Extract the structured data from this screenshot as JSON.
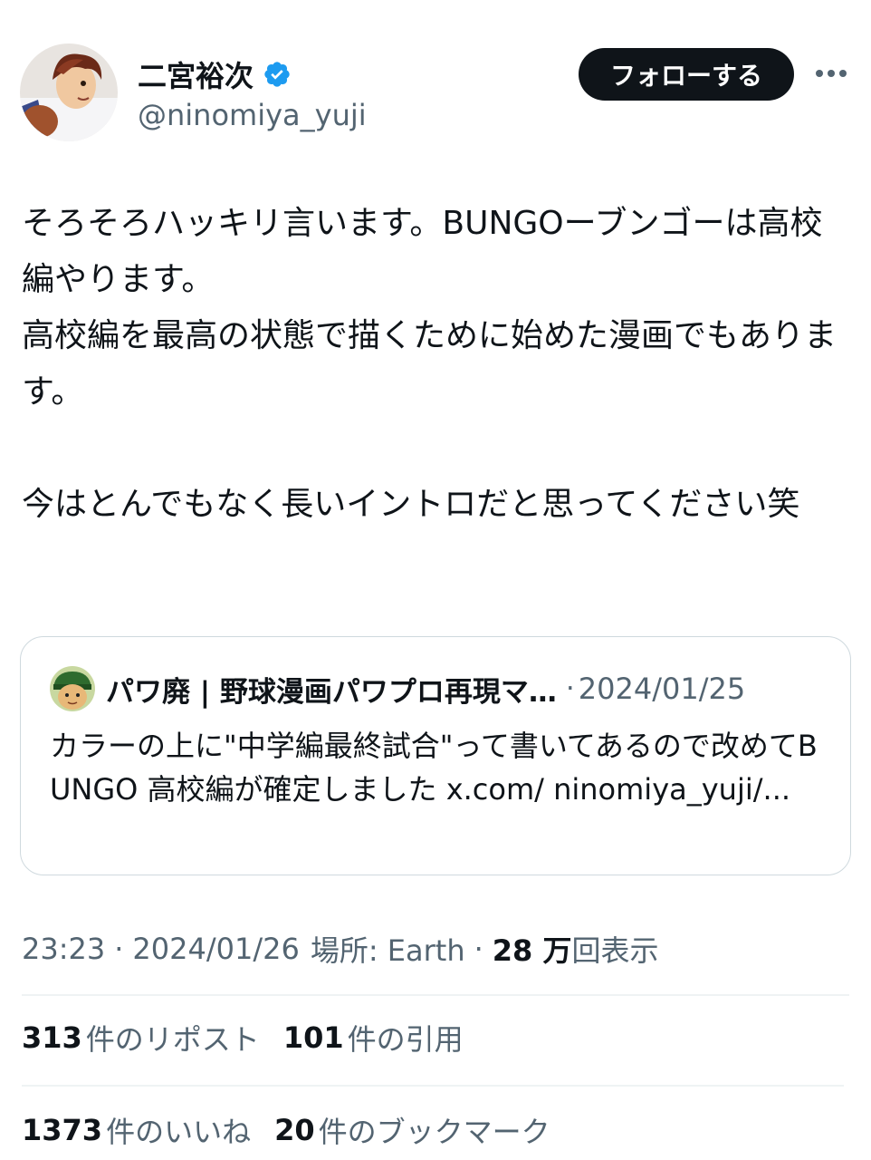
{
  "author": {
    "display_name": "二宮裕次",
    "handle": "@ninomiya_yuji",
    "verified_icon": "verified-badge-icon",
    "avatar_icon": "avatar-illustration"
  },
  "actions": {
    "follow_label": "フォローする",
    "more_icon": "more-horizontal-icon"
  },
  "tweet": {
    "text": "そろそろハッキリ言います。BUNGOーブンゴーは高校編やります。\n高校編を最高の状態で描くために始めた漫画でもあります。\n\n今はとんでもなく長いイントロだと思ってください笑"
  },
  "quote": {
    "name": "パワ廃 | 野球漫画パワプロ再現マ…",
    "separator": "·",
    "date": "2024/01/25",
    "text": "カラーの上に\"中学編最終試合\"って書いてあるので改めてBUNGO 高校編が確定しました x.com/ ninomiya_yuji/..."
  },
  "meta": {
    "time": "23:23",
    "sep1": "·",
    "date": "2024/01/26",
    "location": "場所: Earth",
    "sep2": "·",
    "views_num": "28 万",
    "views_label": "回表示"
  },
  "stats": {
    "reposts_num": "313",
    "reposts_label": "件のリポスト",
    "quotes_num": "101",
    "quotes_label": "件の引用",
    "likes_num": "1373",
    "likes_label": "件のいいね",
    "bookmarks_num": "20",
    "bookmarks_label": "件のブックマーク"
  },
  "colors": {
    "text": "#0f1419",
    "secondary": "#536471",
    "verified": "#1d9bf0",
    "border": "#cfd9de",
    "divider": "#eff3f4"
  }
}
